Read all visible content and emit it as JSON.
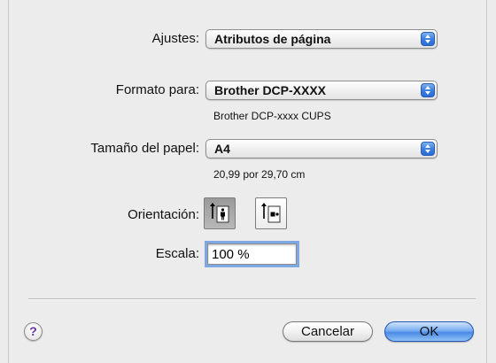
{
  "settings": {
    "label": "Ajustes:",
    "value": "Atributos de página"
  },
  "format_for": {
    "label": "Formato para:",
    "value": "Brother DCP-XXXX",
    "detail": "Brother DCP-xxxx CUPS"
  },
  "paper_size": {
    "label": "Tamaño del papel:",
    "value": "A4",
    "detail": "20,99 por 29,70 cm"
  },
  "orientation": {
    "label": "Orientación:",
    "options": [
      "portrait",
      "landscape"
    ],
    "selected": "portrait"
  },
  "scale": {
    "label": "Escala:",
    "value": "100 %"
  },
  "buttons": {
    "help": "?",
    "cancel": "Cancelar",
    "ok": "OK"
  },
  "colors": {
    "accent": "#3c7fe0",
    "window_bg": "#ececec",
    "help_glyph": "#6a2fa0"
  }
}
